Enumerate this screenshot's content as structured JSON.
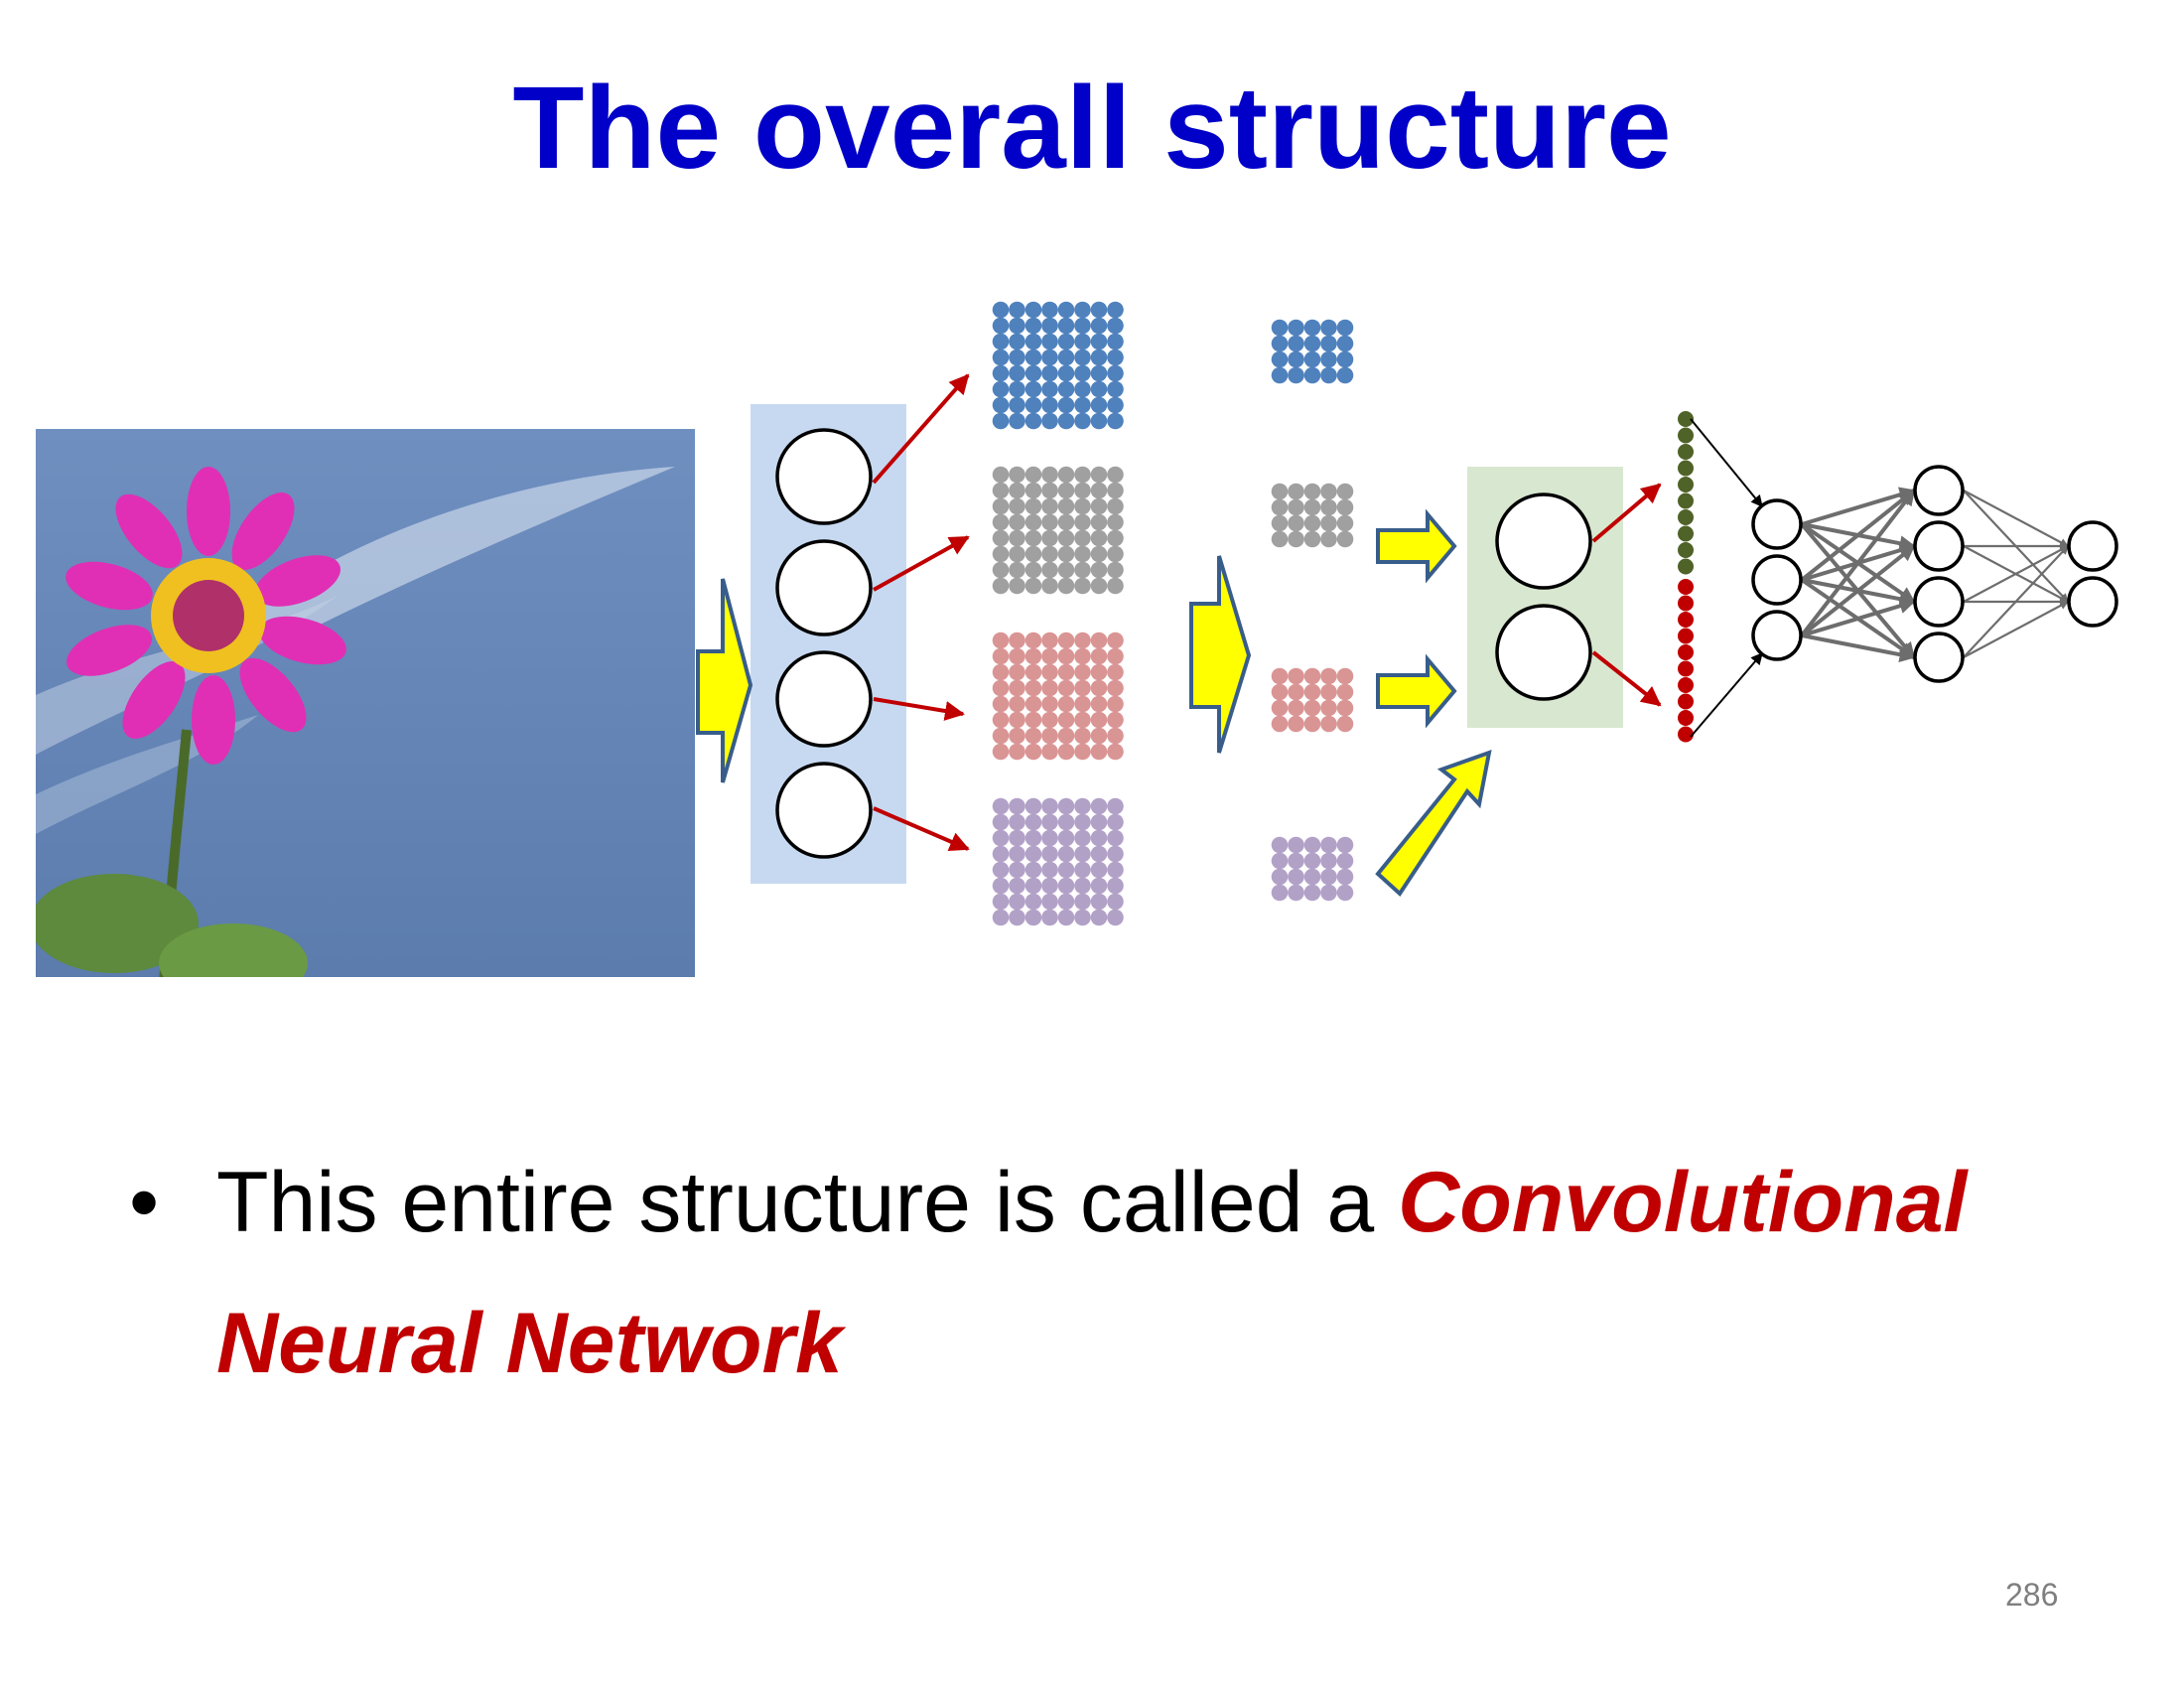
{
  "slide": {
    "title": "The overall structure",
    "bullet_symbol": "•",
    "bullet_text_plain": "This entire structure is called a ",
    "bullet_text_emphasis_1": "Convolutional",
    "bullet_text_emphasis_2": "Neural Network",
    "page_number": "286"
  },
  "colors": {
    "title": "#0000c8",
    "emphasis": "#c00000",
    "feature_map_blue": "#4f81bd",
    "feature_map_gray": "#a0a0a0",
    "feature_map_red": "#d99594",
    "feature_map_purple": "#b2a1c7",
    "filter_panel_blue": "#c6d9f1",
    "filter_panel_green": "#d8e8d0",
    "flat_green": "#4f6228",
    "flat_red": "#c00000",
    "arrow_yellow": "#ffff00",
    "arrow_border": "#385d8a",
    "red_arrow": "#c00000",
    "mlp_edge": "#6d6d6d"
  },
  "diagram": {
    "input_image": "flower-photo",
    "stage1_filters": 4,
    "stage1_maps": {
      "rows": 8,
      "cols": 8
    },
    "stage2_maps": {
      "rows": 4,
      "cols": 5
    },
    "stage2_filters": 2,
    "flattened_green": 10,
    "flattened_red": 10,
    "mlp_layers": [
      3,
      4,
      2
    ]
  }
}
